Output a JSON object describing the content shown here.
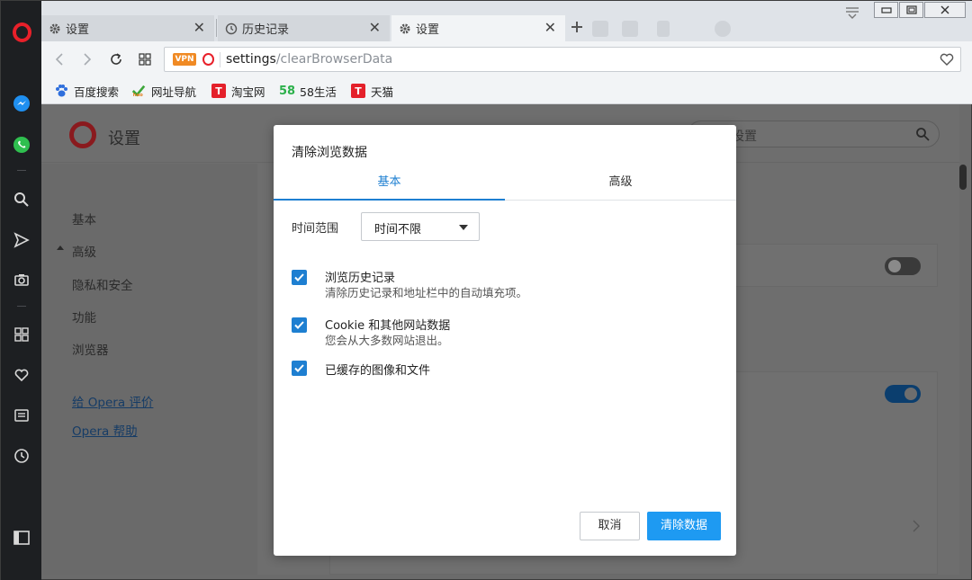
{
  "tabs": [
    {
      "label": "设置",
      "icon": "gear-icon",
      "state": "inactive"
    },
    {
      "label": "历史记录",
      "icon": "clock-icon",
      "state": "inactive"
    },
    {
      "label": "设置",
      "icon": "gear-icon",
      "state": "active"
    }
  ],
  "address": {
    "vpn_badge": "VPN",
    "url_host": "settings",
    "url_path": "/clearBrowserData"
  },
  "bookmarks": [
    {
      "label": "百度搜索",
      "icon": "baidu-paw-icon"
    },
    {
      "label": "网址导航",
      "icon": "hao123-icon"
    },
    {
      "label": "淘宝网",
      "icon": "taobao-icon"
    },
    {
      "label": "58生活",
      "icon": "58-icon"
    },
    {
      "label": "天猫",
      "icon": "tmall-icon"
    }
  ],
  "settings_page": {
    "title": "设置",
    "search_placeholder": "设置",
    "nav": {
      "basic": "基本",
      "advanced": "高级",
      "privacy": "隐私和安全",
      "features": "功能",
      "browser": "浏览器",
      "rate_opera": "给 Opera 评价",
      "help": "Opera 帮助"
    }
  },
  "dialog": {
    "title": "清除浏览数据",
    "tabs": [
      "基本",
      "高级"
    ],
    "active_tab": "基本",
    "time_range_label": "时间范围",
    "time_range_value": "时间不限",
    "options": [
      {
        "title": "浏览历史记录",
        "desc": "清除历史记录和地址栏中的自动填充项。",
        "checked": true
      },
      {
        "title": "Cookie 和其他网站数据",
        "desc": "您会从大多数网站退出。",
        "checked": true
      },
      {
        "title": "已缓存的图像和文件",
        "desc": "",
        "checked": true
      }
    ],
    "cancel_label": "取消",
    "clear_label": "清除数据"
  },
  "colors": {
    "accent": "#1e7fd1",
    "primary_button": "#1e9af2",
    "opera_red": "#e8202a",
    "sidebar_bg": "#1d1f22"
  }
}
